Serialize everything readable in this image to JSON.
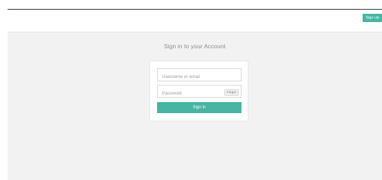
{
  "header": {
    "signup_label": "Sign Up"
  },
  "login": {
    "title": "Sign in to your Account",
    "username_placeholder": "Username or email",
    "password_placeholder": "Password",
    "forgot_label": "Forgot",
    "signin_label": "Sign In"
  },
  "colors": {
    "accent": "#45b5a4",
    "background": "#f2f2f2",
    "card": "#ffffff"
  }
}
